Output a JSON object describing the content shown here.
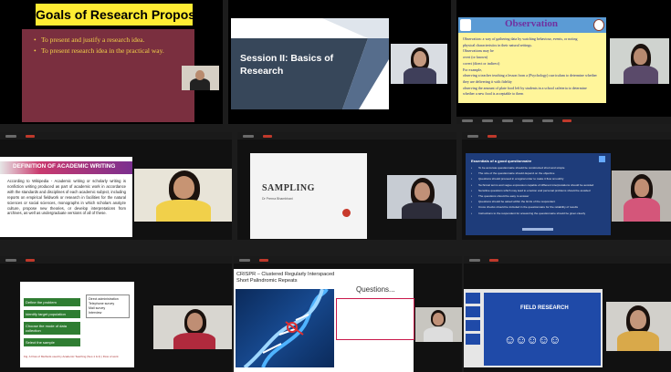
{
  "t1": {
    "title": "Goals of Research Proposal",
    "bullets": [
      "To present and justify a research idea.",
      "To present research idea in the practical way."
    ]
  },
  "t2": {
    "title_line1": "Session II: Basics of",
    "title_line2": "Research"
  },
  "t3": {
    "title": "Observation",
    "line1": "Observation: a way of gathering data by watching behaviour, events, or noting",
    "line2": "physical characteristics in their natural settings.",
    "line3": "Observations may be",
    "line4": "overt (or known)",
    "line5": "covert (direct or indirect)",
    "line6": "For example,",
    "line7": "observing a teacher teaching a lesson from a (Psychology) curriculum to determine whether",
    "line8": "they are delivering it with fidelity",
    "line9": "observing the amount of plate food left by students in a school cafeteria to determine",
    "line10": "whether a new food is acceptable to them"
  },
  "t4": {
    "title": "DEFINITION OF ACADEMIC WRITING",
    "body": "According to Wikipedia - Academic writing or scholarly writing is nonfiction writing produced as part of academic work in accordance with the standards and disciplines of each academic subject, including reports on empirical fieldwork or research in facilities for the natural sciences or social sciences, monographs in which scholars analyze culture, propose new theories, or develop interpretations from archives, as well as undergraduate versions of all of these."
  },
  "t5": {
    "title": "SAMPLING",
    "subtitle": "Dr Prerna Bhambhani"
  },
  "t6": {
    "title": "Essentials of a good questionnaire",
    "items": [
      "To be accurate questionnaire should be constructed short and simple",
      "The size of the questionnaire should depend on the objective",
      "Questions should proceed in a logical order to make it flow smoothly",
      "Technical terms and vague expression capable of different interpretations should be avoided",
      "Sensitive questions which may lead to emotion and personal problems should be avoided",
      "The questions should be easy to answer",
      "Questions should be asked within the limits of the respondent",
      "Cross checks should be included in the questionnaire for the reliability of results",
      "Instructions to the respondent for answering the questionnaire should be given clearly"
    ]
  },
  "t7": {
    "col_left": [
      "Define the problem",
      "Identify target population",
      "Choose the mode of data collection",
      "Select the sample"
    ],
    "col_right": [
      "Direct administration",
      "Telephone survey",
      "Mail survey",
      "Interview"
    ],
    "caption": "Fig. A Flow of Methods used by Academic Teaching (Sec-1 & 2) | Flow of work"
  },
  "t8": {
    "title_line1": "CRISPR – Clustered Regularly Interspaced",
    "title_line2": "Short Palindromic Repeats",
    "questions": "Questions..."
  },
  "t9": {
    "title": "FIELD RESEARCH"
  }
}
